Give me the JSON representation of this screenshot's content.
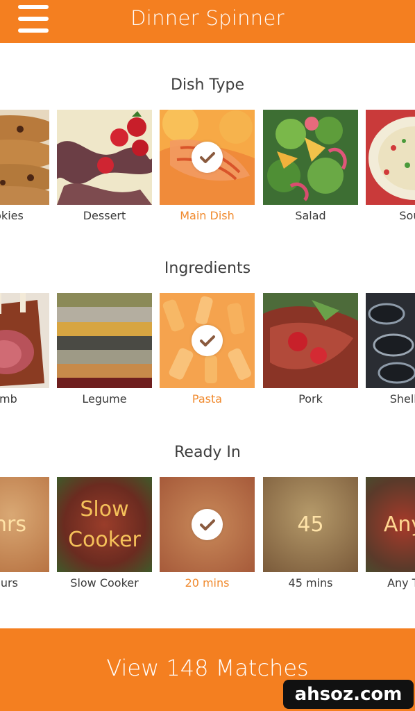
{
  "header": {
    "title": "Dinner Spinner",
    "menu_icon": "hamburger-menu-icon"
  },
  "sections": {
    "dish_type": {
      "title": "Dish Type",
      "items": [
        {
          "label": "Cookies",
          "selected": false
        },
        {
          "label": "Dessert",
          "selected": false
        },
        {
          "label": "Main Dish",
          "selected": true
        },
        {
          "label": "Salad",
          "selected": false
        },
        {
          "label": "Soup",
          "selected": false
        }
      ]
    },
    "ingredients": {
      "title": "Ingredients",
      "items": [
        {
          "label": "Lamb",
          "selected": false
        },
        {
          "label": "Legume",
          "selected": false
        },
        {
          "label": "Pasta",
          "selected": true
        },
        {
          "label": "Pork",
          "selected": false
        },
        {
          "label": "Shellfish",
          "selected": false
        }
      ]
    },
    "ready_in": {
      "title": "Ready In",
      "items": [
        {
          "label": "Hours",
          "overlay": "hrs",
          "selected": false
        },
        {
          "label": "Slow Cooker",
          "overlay_lines": [
            "Slow",
            "Cooker"
          ],
          "selected": false
        },
        {
          "label": "20 mins",
          "selected": true
        },
        {
          "label": "45 mins",
          "overlay": "45",
          "selected": false
        },
        {
          "label": "Any Time",
          "overlay": "Any",
          "selected": false
        }
      ]
    }
  },
  "footer": {
    "cta": "View 148 Matches"
  },
  "watermark": "ahsoz.com",
  "colors": {
    "accent": "#f47f20",
    "selected_label": "#f08a2e",
    "text": "#3a3a3a"
  }
}
